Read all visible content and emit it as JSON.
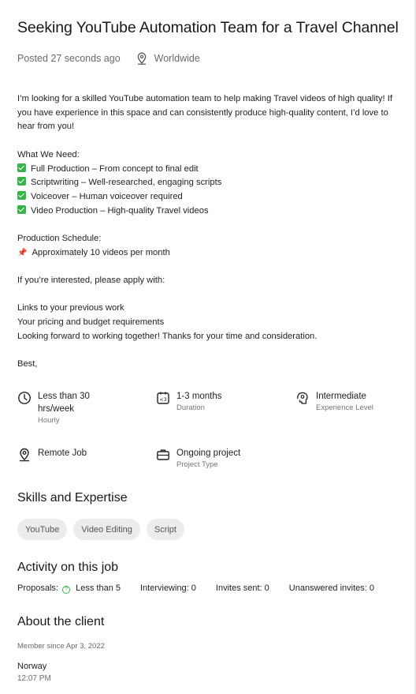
{
  "job": {
    "title": "Seeking YouTube Automation Team for a Travel Channel",
    "posted": "Posted 27 seconds ago",
    "location": "Worldwide"
  },
  "description": {
    "intro_1": "I’m looking for a skilled YouTube automation team to help making Travel videos of high quality!  If",
    "intro_2": "you have experience in this space and can consistently produce high-quality content, I’d love to",
    "intro_3": "hear from you!",
    "needs_heading": "What We Need:",
    "needs": [
      "Full Production – From concept to final edit",
      "Scriptwriting – Well-researched, engaging scripts",
      "Voiceover – Human voiceover required",
      "Video Production – High-quality Travel videos"
    ],
    "schedule_heading": "Production Schedule:",
    "schedule_item": "Approximately 10 videos per month",
    "apply_heading": "If you’re interested, please apply with:",
    "apply_lines": [
      "Links to your previous work",
      "Your pricing and budget requirements",
      "Looking forward to working together! Thanks for your time and consideration."
    ],
    "signoff": "Best,"
  },
  "features": {
    "hours_1": "Less than 30",
    "hours_2": "hrs/week",
    "hours_sub": "Hourly",
    "duration": "1-3 months",
    "duration_sub": "Duration",
    "level": "Intermediate",
    "level_sub": "Experience Level",
    "remote": "Remote Job",
    "project": "Ongoing project",
    "project_sub": "Project Type"
  },
  "skills": {
    "heading": "Skills and Expertise",
    "items": [
      "YouTube",
      "Video Editing",
      "Script"
    ]
  },
  "activity": {
    "heading": "Activity on this job",
    "proposals_label": "Proposals:",
    "proposals_value": "Less than 5",
    "interviewing": "Interviewing: 0",
    "invites": "Invites sent: 0",
    "unanswered": "Unanswered invites: 0"
  },
  "client": {
    "heading": "About the client",
    "member_since": "Member since Apr 3, 2022",
    "country": "Norway",
    "time": "12:07 PM"
  },
  "colors": {
    "check": "#37b34a",
    "chip_bg": "#ececec"
  }
}
